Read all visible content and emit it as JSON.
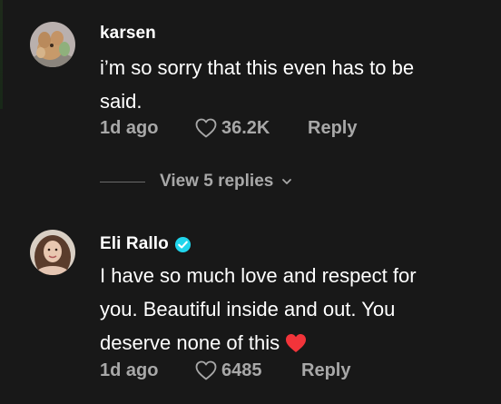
{
  "comments": [
    {
      "username": "karsen",
      "verified": false,
      "text_lines": [
        "i’m so sorry that this even has to be",
        "said."
      ],
      "time": "1d ago",
      "likes": "36.2K",
      "reply_label": "Reply",
      "view_replies_label": "View 5 replies",
      "avatar_icon": "avatar-plush-toy"
    },
    {
      "username": "Eli Rallo",
      "verified": true,
      "text_lines": [
        "I have so much love and respect for",
        "you. Beautiful inside and out. You",
        "deserve none of this"
      ],
      "trailing_emoji": "red-heart",
      "time": "1d ago",
      "likes": "6485",
      "reply_label": "Reply",
      "avatar_icon": "avatar-person-photo"
    }
  ],
  "colors": {
    "background": "#181818",
    "primary_text": "#ffffff",
    "secondary_text": "#a8a8a8",
    "verified_badge": "#20d5ec",
    "heart_emoji": "#f2343a"
  }
}
